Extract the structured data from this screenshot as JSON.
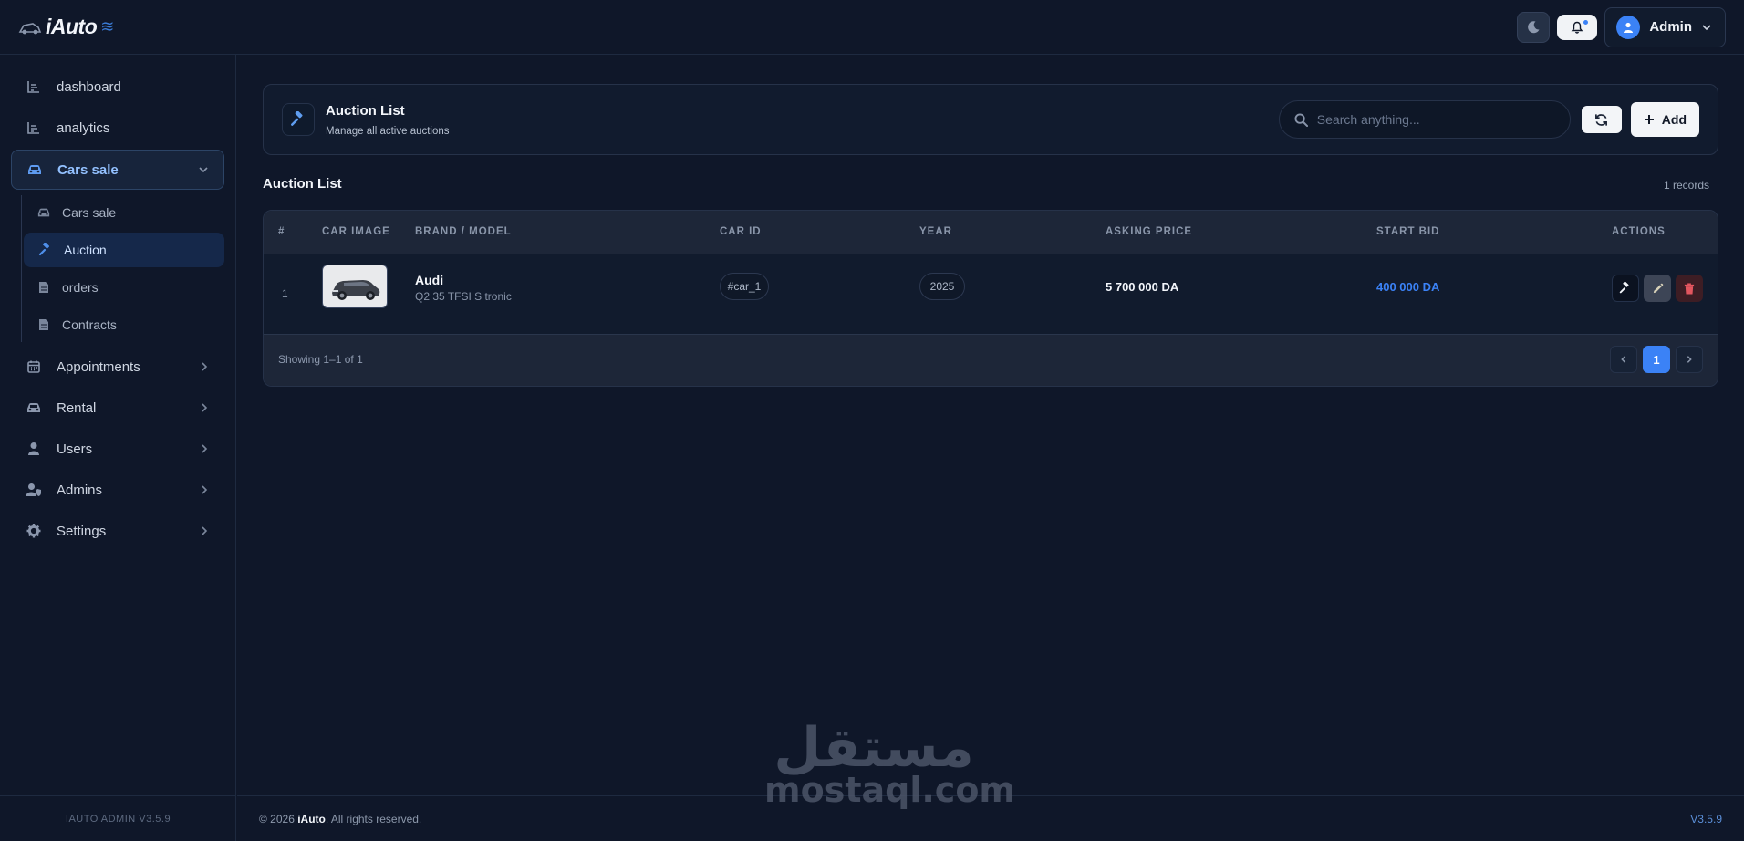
{
  "app": {
    "logo_text": "iAuto",
    "brand_color": "#3b82f6"
  },
  "topbar": {
    "theme_icon": "moon-icon",
    "notification_icon": "bell-icon",
    "user_name": "Admin"
  },
  "sidebar": {
    "items": [
      {
        "label": "dashboard",
        "icon": "chart-bars-icon"
      },
      {
        "label": "analytics",
        "icon": "chart-bars-icon"
      },
      {
        "label": "Cars sale",
        "icon": "car-icon",
        "expanded": true
      },
      {
        "label": "Appointments",
        "icon": "calendar-icon"
      },
      {
        "label": "Rental",
        "icon": "car-icon"
      },
      {
        "label": "Users",
        "icon": "user-icon"
      },
      {
        "label": "Admins",
        "icon": "user-shield-icon"
      },
      {
        "label": "Settings",
        "icon": "gear-icon"
      }
    ],
    "sub_items": [
      {
        "label": "Cars sale",
        "icon": "car-icon"
      },
      {
        "label": "Auction",
        "icon": "gavel-icon",
        "active": true
      },
      {
        "label": "orders",
        "icon": "document-icon"
      },
      {
        "label": "Contracts",
        "icon": "document-icon"
      }
    ],
    "footer": "IAUTO ADMIN V3.5.9"
  },
  "page_header": {
    "title": "Auction List",
    "subtitle": "Manage all active auctions",
    "search_placeholder": "Search anything...",
    "add_label": "Add"
  },
  "list": {
    "title": "Auction List",
    "records": "1 records",
    "columns": [
      "#",
      "CAR IMAGE",
      "BRAND / MODEL",
      "CAR ID",
      "YEAR",
      "ASKING PRICE",
      "START BID",
      "ACTIONS"
    ],
    "rows": [
      {
        "index": "1",
        "brand": "Audi",
        "model": "Q2 35 TFSI S tronic",
        "car_id": "#car_1",
        "year": "2025",
        "asking_price": "5 700 000 DA",
        "start_bid": "400 000 DA"
      }
    ],
    "showing": "Showing 1–1 of 1",
    "current_page": "1"
  },
  "footer": {
    "copyright_prefix": "© 2026",
    "copyright_brand": "iAuto",
    "copyright_suffix": ". All rights reserved.",
    "version": "V3.5.9"
  },
  "watermark": {
    "arabic": "مستقل",
    "latin": "mostaql.com"
  }
}
